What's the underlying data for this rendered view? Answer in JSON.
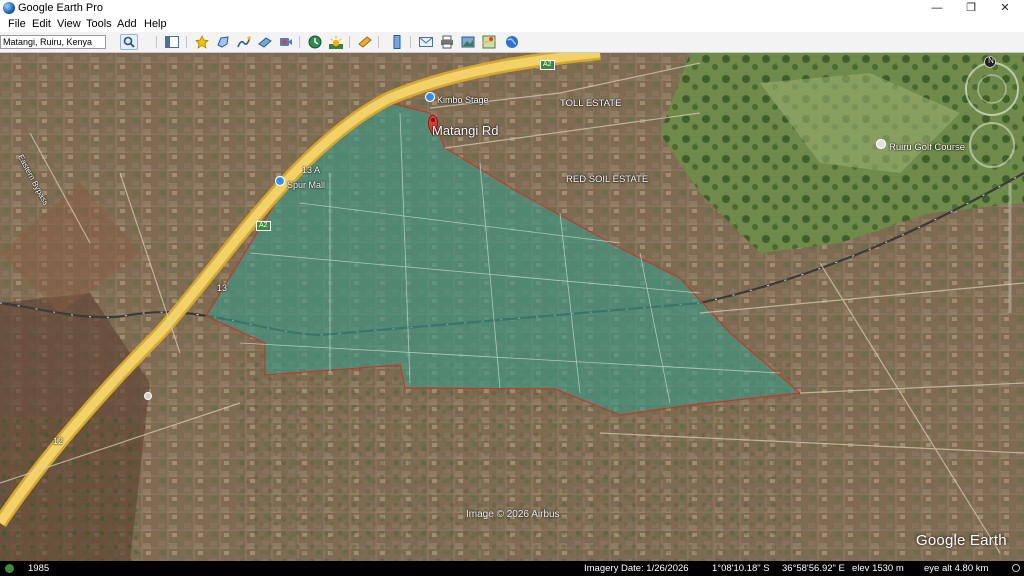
{
  "window": {
    "title": "Google Earth Pro",
    "minimize_glyph": "—",
    "maximize_glyph": "❐",
    "close_glyph": "✕"
  },
  "menu": {
    "items": [
      "File",
      "Edit",
      "View",
      "Tools",
      "Add",
      "Help"
    ]
  },
  "search": {
    "value": "Matangi, Ruiru, Kenya"
  },
  "toolbar": {
    "icons": [
      "sidebar-toggle-icon",
      "add-placemark-icon",
      "add-polygon-icon",
      "add-path-icon",
      "add-image-overlay-icon",
      "record-tour-icon",
      "historical-imagery-icon",
      "sunlight-icon",
      "planets-icon",
      "ruler-icon",
      "email-icon",
      "print-icon",
      "save-image-icon",
      "view-in-maps-icon",
      "earth-icon"
    ]
  },
  "map": {
    "labels": {
      "kimbo_stage": "Kimbo Stage",
      "matangi_rd": "Matangi Rd",
      "toll_estate": "TOLL ESTATE",
      "red_soil_estate": "RED SOIL ESTATE",
      "ruiru_golf_course": "Ruiru Golf Course",
      "spur_mall": "Spur Mall",
      "stop_13a": "13 A",
      "stop_13": "13",
      "stop_12": "12",
      "road_name": "Eastern Bypass",
      "shield_a2": "A2"
    },
    "compass_north": "N",
    "attribution": "Image © 2026 Airbus",
    "brand": "Google Earth"
  },
  "status": {
    "year": "1985",
    "imagery_date": "Imagery Date: 1/26/2026",
    "latitude": "1°08'10.18\" S",
    "longitude": "36°58'56.92\" E",
    "elevation": "elev  1530 m",
    "eye_alt": "eye alt    4.80 km"
  },
  "colors": {
    "polygon_fill": "#3a9a86",
    "polygon_border": "#c0392b",
    "highway": "#e9c44c",
    "placemark_red": "#e53935",
    "poi_blue": "#2f8fe0"
  }
}
